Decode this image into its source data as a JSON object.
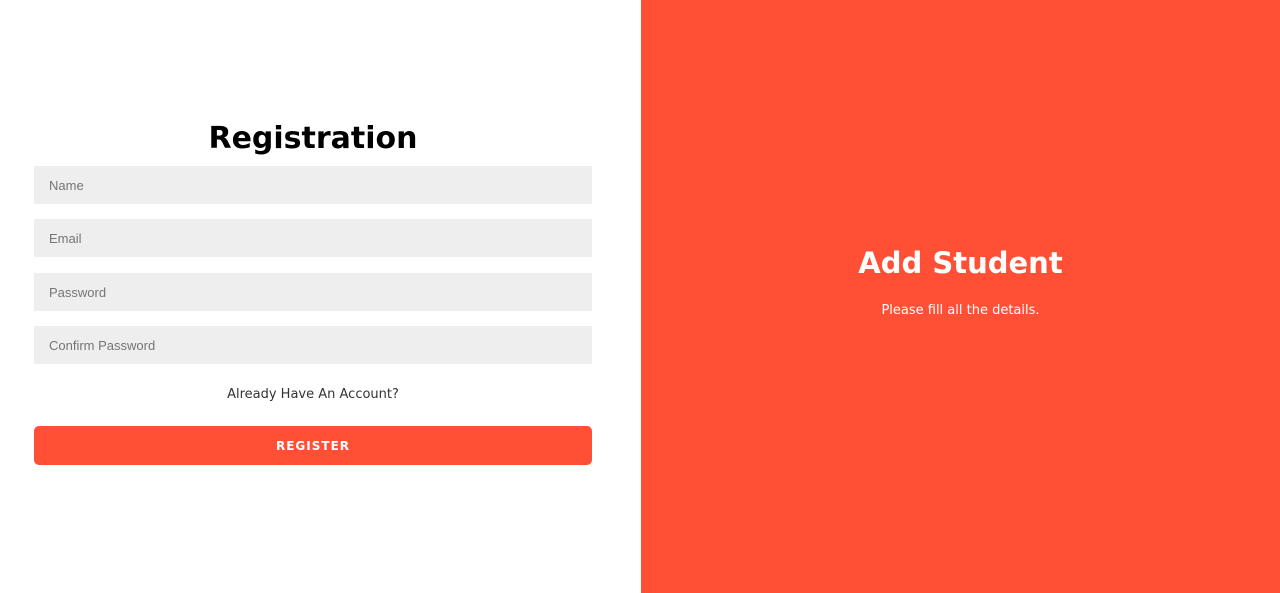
{
  "colors": {
    "accent": "#ff4f35",
    "field_background": "#eeeeee",
    "text_dark": "#000000"
  },
  "form": {
    "title": "Registration",
    "fields": {
      "name_placeholder": "Name",
      "email_placeholder": "Email",
      "password_placeholder": "Password",
      "confirm_password_placeholder": "Confirm Password"
    },
    "account_link": "Already Have An Account?",
    "register_button": "REGISTER"
  },
  "side_panel": {
    "title": "Add Student",
    "subtitle": "Please fill all the details."
  }
}
